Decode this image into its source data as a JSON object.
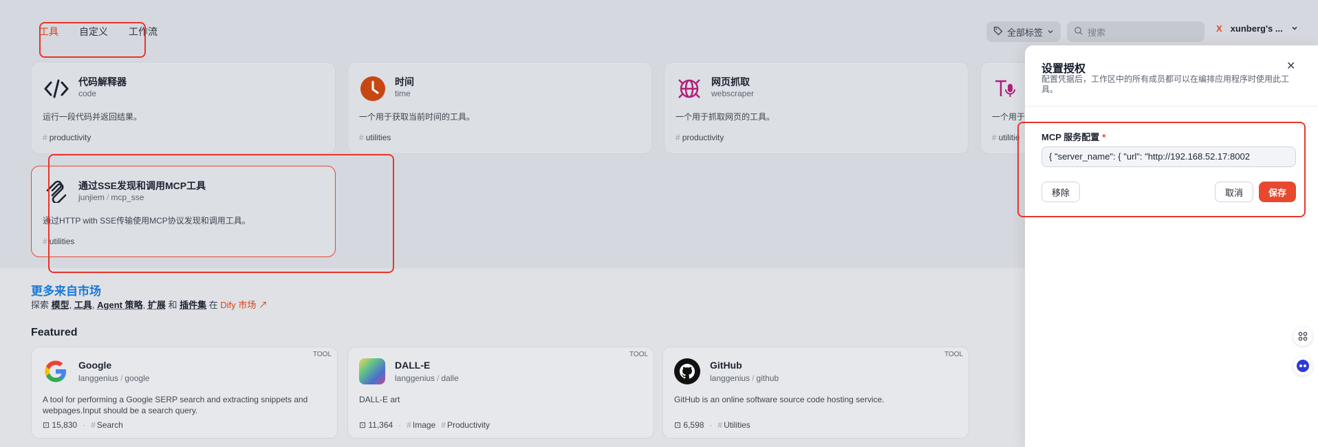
{
  "tabs": [
    {
      "label": "工具"
    },
    {
      "label": "自定义"
    },
    {
      "label": "工作流"
    }
  ],
  "header": {
    "tag_filter_label": "全部标签",
    "search_placeholder": "搜索",
    "workspace_initial": "X",
    "workspace_name": "xunberg's ..."
  },
  "tools": [
    {
      "name": "代码解释器",
      "sub": "code",
      "desc": "运行一段代码并返回结果。",
      "tag": "productivity",
      "icon": "code-icon"
    },
    {
      "name": "时间",
      "sub": "time",
      "desc": "一个用于获取当前时间的工具。",
      "tag": "utilities",
      "icon": "clock-icon"
    },
    {
      "name": "网页抓取",
      "sub": "webscraper",
      "desc": "一个用于抓取网页的工具。",
      "tag": "productivity",
      "icon": "globe-icon"
    },
    {
      "name": "",
      "sub": "",
      "desc": "一个用于",
      "tag": "utilitie",
      "icon": "tts-icon"
    },
    {
      "name": "通过SSE发现和调用MCP工具",
      "sub_org": "junjiem",
      "sub_sep": "/",
      "sub_pkg": "mcp_sse",
      "desc": "通过HTTP with SSE传输使用MCP协议发现和调用工具。",
      "tag": "utilities",
      "icon": "mcp-icon"
    }
  ],
  "market": {
    "title": "更多来自市场",
    "sub_prefix": "探索",
    "sub_links": [
      "模型",
      "工具",
      "Agent 策略",
      "扩展"
    ],
    "sub_and": "和",
    "sub_last": "插件集",
    "sub_in": "在",
    "dify_link": "Dify 市场 ↗",
    "featured_label": "Featured"
  },
  "featured": [
    {
      "badge": "TOOL",
      "name": "Google",
      "org": "langgenius",
      "pkg": "google",
      "desc": "A tool for performing a Google SERP search and extracting snippets and webpages.Input should be a search query.",
      "installs": "15,830",
      "tags": [
        "Search"
      ],
      "icon": "google-icon"
    },
    {
      "badge": "TOOL",
      "name": "DALL-E",
      "org": "langgenius",
      "pkg": "dalle",
      "desc": "DALL-E art",
      "installs": "11,364",
      "tags": [
        "Image",
        "Productivity"
      ],
      "icon": "dalle-icon"
    },
    {
      "badge": "TOOL",
      "name": "GitHub",
      "org": "langgenius",
      "pkg": "github",
      "desc": "GitHub is an online software source code hosting service.",
      "installs": "6,598",
      "tags": [
        "Utilities"
      ],
      "icon": "github-icon"
    }
  ],
  "dialog": {
    "title": "设置授权",
    "description": "配置凭据后，工作区中的所有成员都可以在编排应用程序时使用此工具。",
    "field_label": "MCP 服务配置",
    "required_mark": "*",
    "field_value": "{  \"server_name\": {    \"url\": \"http://192.168.52.17:8002",
    "remove_label": "移除",
    "cancel_label": "取消",
    "save_label": "保存",
    "close_glyph": "✕"
  },
  "colors": {
    "accent": "#e8482d",
    "highlight": "#e8342a",
    "market_blue": "#1a78d6"
  }
}
